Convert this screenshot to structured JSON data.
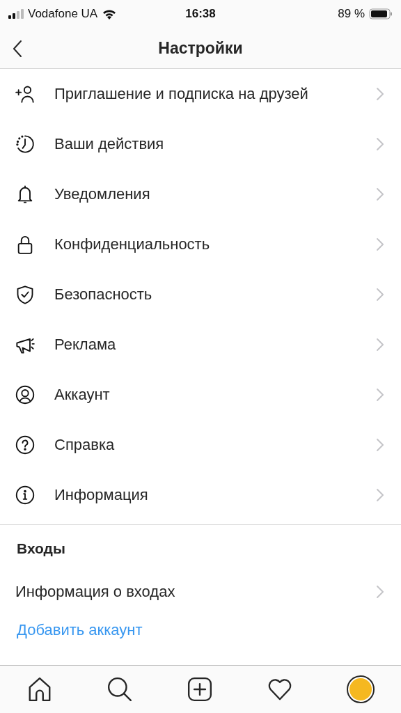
{
  "status_bar": {
    "carrier": "Vodafone UA",
    "time": "16:38",
    "battery": "89 %"
  },
  "header": {
    "title": "Настройки"
  },
  "menu": [
    {
      "kind": "add-person",
      "label": "Приглашение и подписка на друзей"
    },
    {
      "kind": "activity",
      "label": "Ваши действия"
    },
    {
      "kind": "bell",
      "label": "Уведомления"
    },
    {
      "kind": "lock",
      "label": "Конфиденциальность"
    },
    {
      "kind": "shield",
      "label": "Безопасность"
    },
    {
      "kind": "megaphone",
      "label": "Реклама"
    },
    {
      "kind": "account",
      "label": "Аккаунт"
    },
    {
      "kind": "help",
      "label": "Справка"
    },
    {
      "kind": "info",
      "label": "Информация"
    }
  ],
  "logins": {
    "title": "Входы",
    "items": [
      {
        "label": "Информация о входах"
      }
    ],
    "link": "Добавить аккаунт"
  },
  "tab_bar": [
    {
      "kind": "home"
    },
    {
      "kind": "search"
    },
    {
      "kind": "add"
    },
    {
      "kind": "heart"
    },
    {
      "kind": "profile"
    }
  ]
}
